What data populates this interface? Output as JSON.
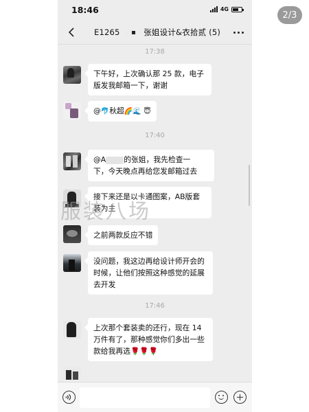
{
  "page_counter": "2/3",
  "status_bar": {
    "time": "18:46",
    "network": "4G",
    "battery_level": 0.7
  },
  "header": {
    "title": "E1265         张姐设计&衣拾贰 (5)"
  },
  "timestamps": [
    "17:38",
    "17:40",
    "17:46"
  ],
  "messages": [
    {
      "avatar": "avatar-1",
      "lines": [
        "下午好，上次确认那 25 款，电子",
        "版发我邮箱一下，谢谢"
      ]
    },
    {
      "avatar": "avatar-2",
      "prefix": "@",
      "emoji_a": "🐬",
      "name": "秋超",
      "emoji_b": "🌈🌊",
      "emoji_c": "😇"
    },
    {
      "avatar": "avatar-3",
      "lines_a": "@A",
      "lines_a_rest": "的张姐，我先检查一",
      "line2": "下，今天晚点再给您发邮箱过去"
    },
    {
      "avatar": "avatar-4",
      "lines": [
        "接下来还是以卡通图案，AB版套",
        "装为主"
      ]
    },
    {
      "avatar": "avatar-5",
      "lines": [
        "之前两款反应不错"
      ]
    },
    {
      "avatar": "avatar-6",
      "lines": [
        "没问题，我这边再给设计师开会的",
        "时候，让他们按照这种感觉的延展",
        "去开发"
      ]
    },
    {
      "avatar": "avatar-7",
      "lines": [
        "上次那个套装卖的还行，现在 14",
        "万件有了，那种感觉你们多出一些",
        "款给我再选🌹🌹🌹"
      ]
    }
  ],
  "watermark": "服装八场",
  "input": {
    "placeholder": ""
  },
  "icons": {
    "back": "chevron-left-icon",
    "more": "more-icon",
    "voice": "voice-icon",
    "emoji": "emoji-icon",
    "plus": "plus-icon"
  }
}
